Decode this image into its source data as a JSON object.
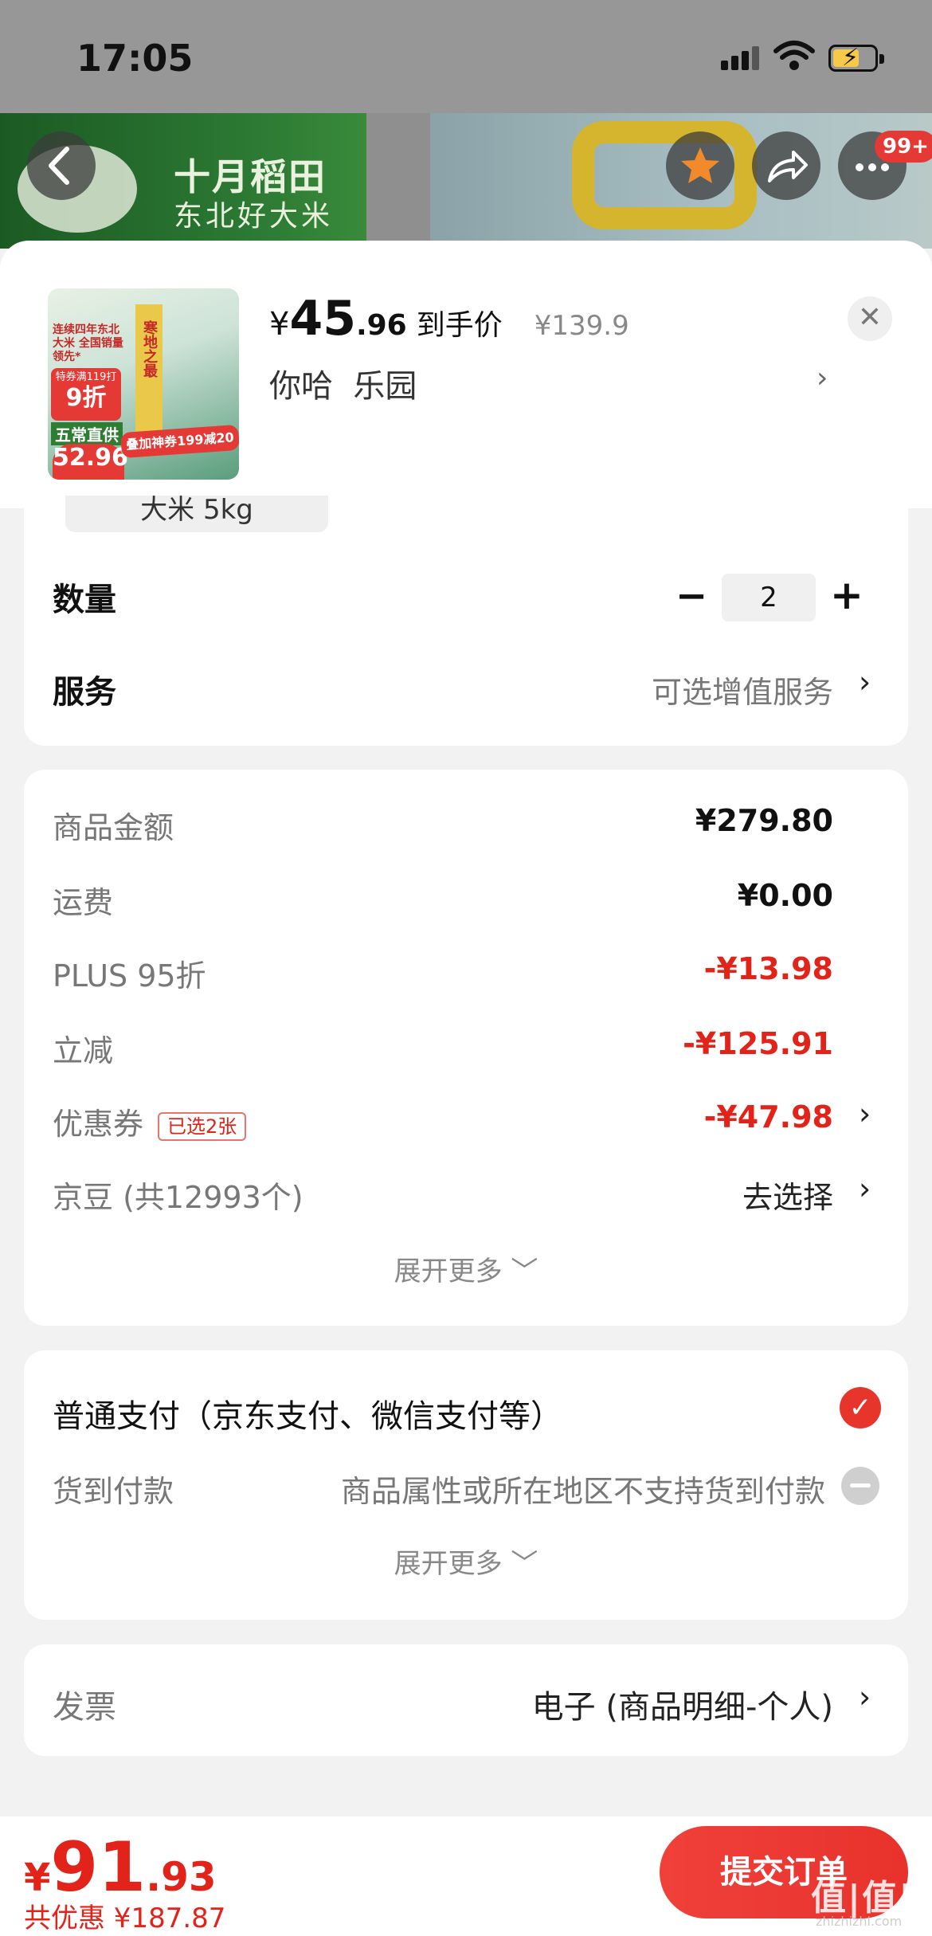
{
  "status_bar": {
    "time": "17:05"
  },
  "banner": {
    "brand_name": "十月稻田",
    "brand_slogan": "东北好大米",
    "notification_badge": "99+"
  },
  "product": {
    "price_symbol": "¥",
    "price_int": "45",
    "price_dec": ".96",
    "price_tag": "到手价",
    "original_price": "¥139.9",
    "address": "你哈  乐园",
    "thumb_text_1": "连续四年东北大米 全国销量领先*",
    "thumb_text_2": "特券满119打",
    "thumb_text_3": "9折",
    "thumb_text_4": "五常直供",
    "thumb_text_5": "52.96",
    "thumb_text_6": "寒地之最",
    "thumb_text_7": "叠加神券199减20"
  },
  "options": {
    "spec_partial": "大米 5kg",
    "quantity_label": "数量",
    "quantity": "2",
    "minus": "−",
    "plus": "+",
    "service_label": "服务",
    "service_value": "可选增值服务"
  },
  "fees": {
    "goods_label": "商品金额",
    "goods_value": "¥279.80",
    "shipping_label": "运费",
    "shipping_value": "¥0.00",
    "plus_label": "PLUS 95折",
    "plus_value": "-¥13.98",
    "instant_label": "立减",
    "instant_value": "-¥125.91",
    "coupon_label": "优惠券",
    "coupon_tag": "已选2张",
    "coupon_value": "-¥47.98",
    "jingdou_label": "京豆 (共12993个)",
    "jingdou_value": "去选择",
    "expand": "展开更多 ﹀"
  },
  "payment": {
    "normal_label": "普通支付（京东支付、微信支付等）",
    "cod_label": "货到付款",
    "cod_note": "商品属性或所在地区不支持货到付款",
    "expand": "展开更多 ﹀"
  },
  "invoice": {
    "label": "发票",
    "value": "电子 (商品明细-个人)"
  },
  "bottom": {
    "total_symbol": "¥",
    "total_int": "91",
    "total_dec": ".93",
    "saved": "共优惠 ¥187.87",
    "submit": "提交订单"
  },
  "watermark": {
    "text": "值|值|值",
    "sub": "zhizhizhi.com"
  },
  "colors": {
    "accent_red": "#e2231a",
    "brand_green": "#2c7a34"
  },
  "icons": [
    "back-icon",
    "favorite-icon",
    "share-icon",
    "more-icon",
    "close-icon",
    "chevron-right-icon",
    "check-icon",
    "disabled-icon"
  ]
}
